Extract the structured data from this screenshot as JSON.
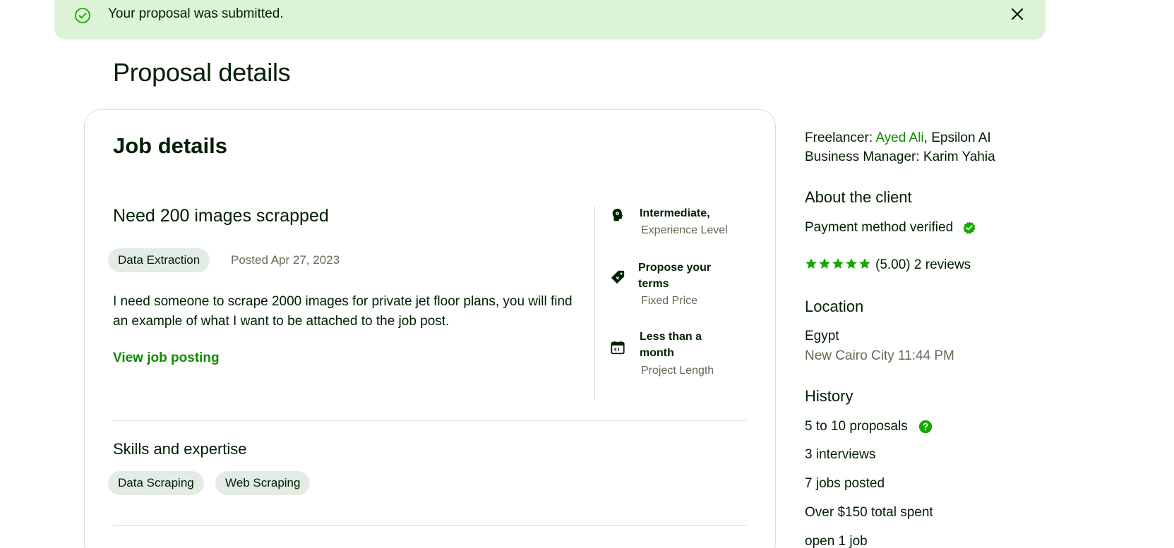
{
  "banner": {
    "message": "Your proposal was submitted."
  },
  "page": {
    "title": "Proposal details"
  },
  "job": {
    "section_title": "Job details",
    "title": "Need 200 images scrapped",
    "category": "Data Extraction",
    "posted": "Posted Apr 27, 2023",
    "description": "I need someone to scrape 2000 images for private jet floor plans, you will find an example of what I want to be attached to the job post.",
    "view_link": "View job posting",
    "meta": [
      {
        "icon": "experience-icon",
        "value": "Intermediate,",
        "label": "Experience Level"
      },
      {
        "icon": "price-tag-icon",
        "value": "Propose your terms",
        "label": "Fixed Price"
      },
      {
        "icon": "calendar-icon",
        "value": "Less than a month",
        "label": "Project Length"
      }
    ],
    "skills_title": "Skills and expertise",
    "skills": [
      "Data Scraping",
      "Web Scraping"
    ]
  },
  "sidebar": {
    "freelancer_label": "Freelancer:",
    "freelancer_name": "Ayed Ali",
    "freelancer_agency": ", Epsilon AI",
    "manager": "Business Manager: Karim Yahia",
    "about_title": "About the client",
    "payment": "Payment method verified",
    "rating": 5,
    "rating_text": "(5.00) 2 reviews",
    "location_title": "Location",
    "country": "Egypt",
    "city_time": "New Cairo City 11:44 PM",
    "history_title": "History",
    "history": [
      "5 to 10 proposals",
      "3 interviews",
      "7 jobs posted",
      "Over $150 total spent",
      "open 1 job"
    ]
  },
  "colors": {
    "accent": "#108a00",
    "banner_bg": "#dcf3d8",
    "chip_bg": "#e4ebe4",
    "text": "#001e00",
    "muted": "#5e6d55"
  }
}
